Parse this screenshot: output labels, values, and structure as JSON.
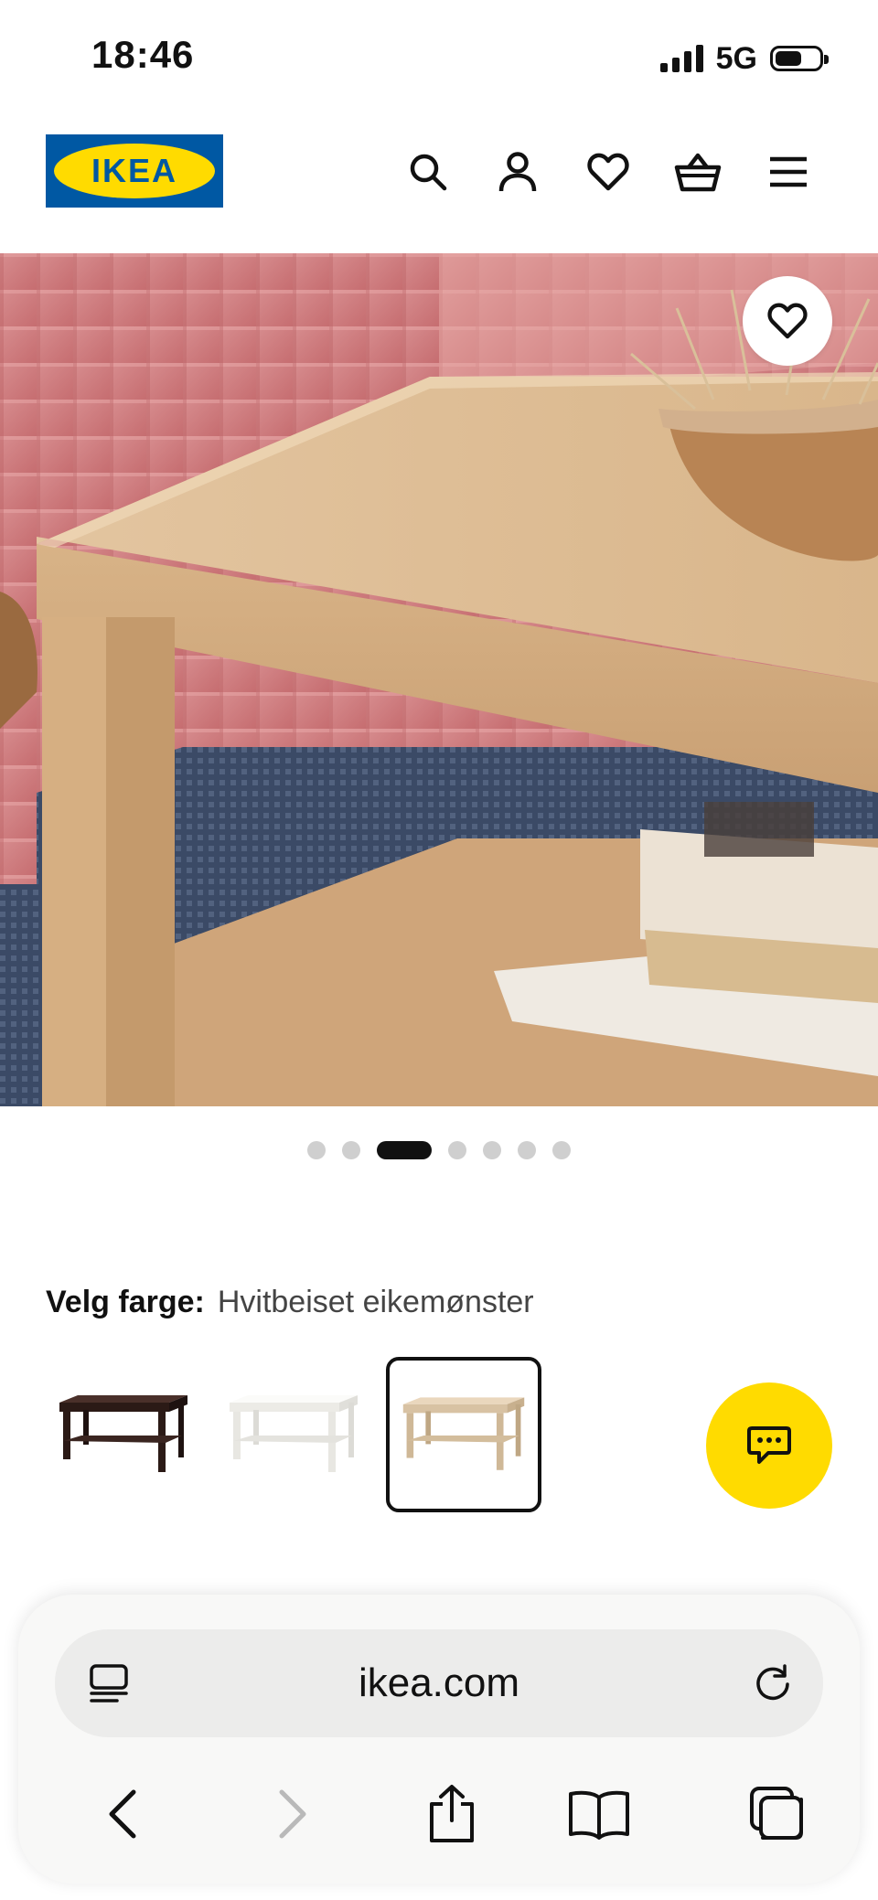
{
  "status_bar": {
    "time": "18:46",
    "network": "5G"
  },
  "header": {
    "logo_text": "IKEA",
    "icons": [
      "search-icon",
      "account-icon",
      "heart-icon",
      "basket-icon",
      "menu-icon"
    ]
  },
  "gallery": {
    "image_count": 7,
    "active_index": 2
  },
  "color_picker": {
    "label": "Velg farge:",
    "selected_value": "Hvitbeiset eikemønster",
    "options": [
      {
        "color": "#2b1a16"
      },
      {
        "color": "#f3f2ee"
      },
      {
        "color": "#d8c2a3"
      }
    ],
    "selected_index": 2
  },
  "browser": {
    "url": "ikea.com"
  },
  "colors": {
    "ikea_blue": "#0058A3",
    "ikea_yellow": "#FFDB00"
  }
}
